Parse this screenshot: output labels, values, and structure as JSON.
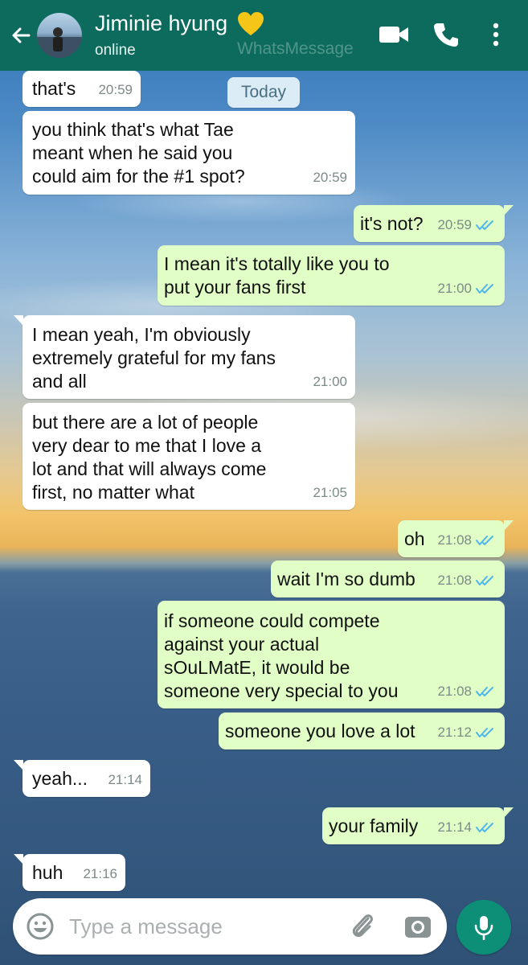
{
  "header": {
    "contact_name": "Jiminie hyung",
    "status": "online",
    "watermark": "WhatsMessage",
    "heart_color": "#f5c518"
  },
  "day_chip": "Today",
  "messages": [
    {
      "dir": "in",
      "text": "that's",
      "time": "20:59"
    },
    {
      "dir": "in",
      "text": "you think that's what Tae\nmeant when he said you\ncould aim for the #1 spot?",
      "time": "20:59"
    },
    {
      "dir": "out",
      "text": "it's not?",
      "time": "20:59",
      "read": true
    },
    {
      "dir": "out",
      "text": "I mean it's totally like you to\nput your fans first",
      "time": "21:00",
      "read": true
    },
    {
      "dir": "in",
      "text": "I mean yeah, I'm obviously\nextremely grateful for my fans\nand all",
      "time": "21:00"
    },
    {
      "dir": "in",
      "text": "but there are a lot of people\nvery dear to me that I love a\nlot and that will always come\nfirst, no matter what",
      "time": "21:05"
    },
    {
      "dir": "out",
      "text": "oh",
      "time": "21:08",
      "read": true
    },
    {
      "dir": "out",
      "text": "wait I'm so dumb",
      "time": "21:08",
      "read": true
    },
    {
      "dir": "out",
      "text": "if someone could compete\nagainst your actual\nsOuLMatE, it would be\nsomeone very special to you",
      "time": "21:08",
      "read": true
    },
    {
      "dir": "out",
      "text": "someone you love a lot",
      "time": "21:12",
      "read": true
    },
    {
      "dir": "in",
      "text": "yeah...",
      "time": "21:14"
    },
    {
      "dir": "out",
      "text": "your family",
      "time": "21:14",
      "read": true
    },
    {
      "dir": "in",
      "text": "huh",
      "time": "21:16"
    }
  ],
  "input": {
    "placeholder": "Type a message"
  },
  "colors": {
    "header_bg": "#0d6b5e",
    "outgoing_bubble": "#e1fec6",
    "incoming_bubble": "#ffffff",
    "read_ticks": "#4fb6ec",
    "mic_button": "#0d8f77"
  },
  "icons": [
    "back-arrow-icon",
    "heart-icon",
    "video-call-icon",
    "phone-icon",
    "more-options-icon",
    "emoji-icon",
    "attach-icon",
    "camera-icon",
    "mic-icon",
    "read-receipt-icon"
  ]
}
